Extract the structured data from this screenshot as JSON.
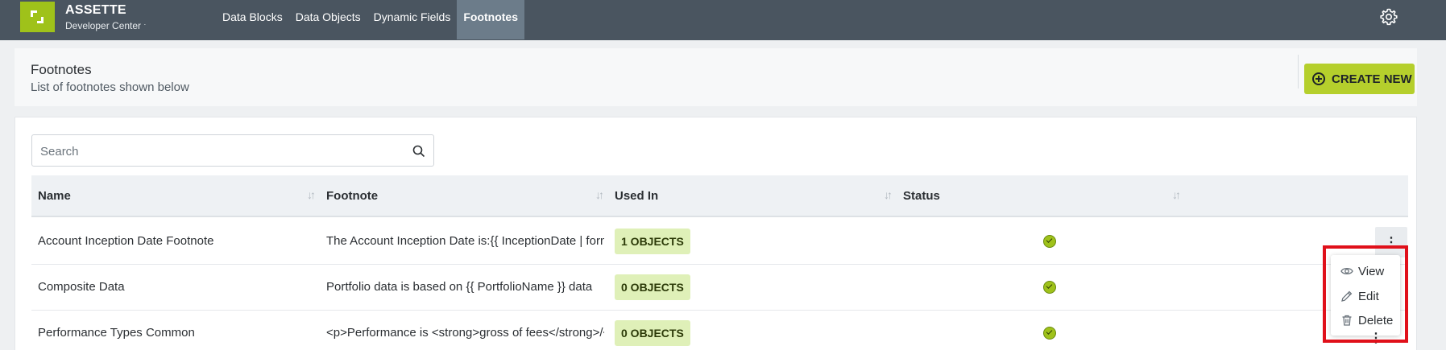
{
  "app": {
    "brand": "ASSETTE",
    "subtitle": "Developer Center",
    "subtitle_suffix": "·"
  },
  "nav": {
    "items": [
      {
        "label": "Data Blocks",
        "active": false
      },
      {
        "label": "Data Objects",
        "active": false
      },
      {
        "label": "Dynamic Fields",
        "active": false
      },
      {
        "label": "Footnotes",
        "active": true
      }
    ],
    "settings_icon": "gear-icon"
  },
  "header": {
    "title": "Footnotes",
    "subtitle": "List of footnotes shown below",
    "create_label": "CREATE NEW",
    "create_icon": "plus-circle-icon"
  },
  "search": {
    "placeholder": "Search",
    "value": ""
  },
  "table": {
    "columns": [
      "Name",
      "Footnote",
      "Used In",
      "Status"
    ],
    "rows": [
      {
        "name": "Account Inception Date Footnote",
        "footnote": "The Account Inception Date is:{{ InceptionDate | format: \"d\" }}",
        "used_in": "1 OBJECTS",
        "status": "active"
      },
      {
        "name": "Composite Data",
        "footnote": "Portfolio data is based on {{ PortfolioName }} data",
        "used_in": "0 OBJECTS",
        "status": "active"
      },
      {
        "name": "Performance Types Common",
        "footnote": "<p>Performance is <strong>gross of fees</strong>/<stron...",
        "used_in": "0 OBJECTS",
        "status": "active"
      }
    ]
  },
  "row_menu": {
    "items": [
      {
        "label": "View",
        "icon": "eye-icon"
      },
      {
        "label": "Edit",
        "icon": "pencil-icon"
      },
      {
        "label": "Delete",
        "icon": "trash-icon"
      }
    ]
  },
  "colors": {
    "topbar": "#4a5560",
    "accent": "#b5cf2c",
    "badge_bg": "#dff0b8",
    "highlight": "#e0101a"
  }
}
